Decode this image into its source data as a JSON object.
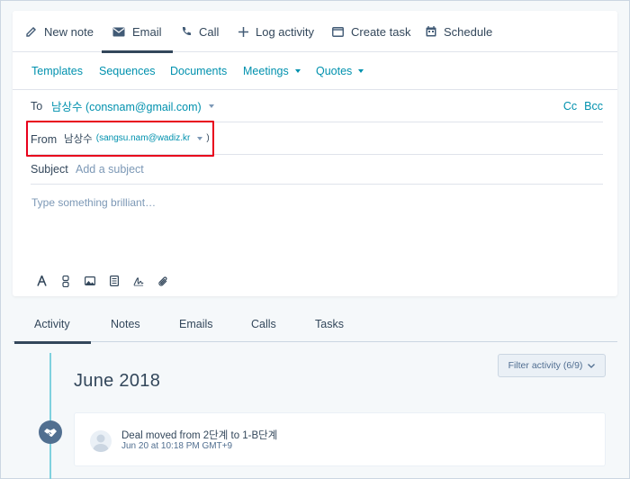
{
  "composer": {
    "tabs": [
      {
        "label": "New note",
        "icon": "pencil-icon"
      },
      {
        "label": "Email",
        "icon": "envelope-icon",
        "active": true
      },
      {
        "label": "Call",
        "icon": "phone-icon"
      },
      {
        "label": "Log activity",
        "icon": "plus-icon"
      },
      {
        "label": "Create task",
        "icon": "task-icon"
      },
      {
        "label": "Schedule",
        "icon": "calendar-icon"
      }
    ],
    "actions": {
      "templates": "Templates",
      "sequences": "Sequences",
      "documents": "Documents",
      "meetings": "Meetings",
      "quotes": "Quotes"
    },
    "to": {
      "label": "To",
      "value": "남상수 (consnam@gmail.com)"
    },
    "cc": "Cc",
    "bcc": "Bcc",
    "from": {
      "label": "From",
      "name": "남상수",
      "email": "(sangsu.nam@wadiz.kr",
      "close": ")"
    },
    "subject": {
      "label": "Subject",
      "placeholder": "Add a subject"
    },
    "body_placeholder": "Type something brilliant…",
    "toolbar": [
      "text-format-icon",
      "personalize-icon",
      "image-icon",
      "document-icon",
      "signature-icon",
      "attachment-icon"
    ]
  },
  "timeline": {
    "tabs": [
      {
        "label": "Activity",
        "active": true
      },
      {
        "label": "Notes"
      },
      {
        "label": "Emails"
      },
      {
        "label": "Calls"
      },
      {
        "label": "Tasks"
      }
    ],
    "filter_label": "Filter activity (6/9)",
    "month": "June 2018",
    "entry": {
      "title": "Deal moved from 2단계 to 1-B단계",
      "timestamp": "Jun 20 at 10:18 PM GMT+9"
    }
  },
  "colors": {
    "accent": "#0091ae",
    "text": "#33475b",
    "highlight": "#e8001c",
    "timeline": "#7fd1de"
  }
}
